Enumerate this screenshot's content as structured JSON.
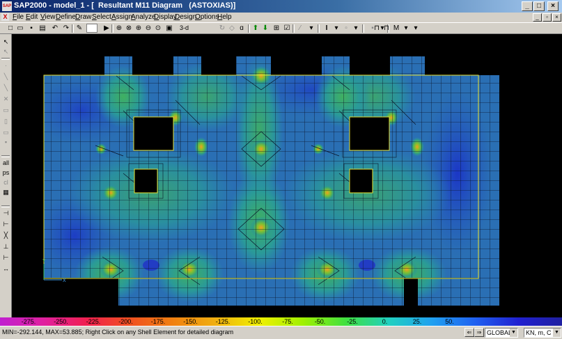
{
  "window": {
    "title": "SAP2000 - model_1 - [  Resultant M11 Diagram   (ASTOXIAS)]",
    "app_icon": "SAP"
  },
  "menu": [
    "File",
    "Edit",
    "View",
    "Define",
    "Draw",
    "Select",
    "Assign",
    "Analyze",
    "Display",
    "Design",
    "Options",
    "Help"
  ],
  "toolbar": {
    "view_3d_label": "3-d",
    "icons": [
      "new-file-icon",
      "open-folder-icon",
      "save-icon",
      "print-icon",
      "undo-icon",
      "redo-icon",
      "pencil-icon",
      "lock-icon",
      "run-icon",
      "zoom-rubber-band-icon",
      "zoom-restore-icon",
      "zoom-in-icon",
      "zoom-out-icon",
      "pan-icon",
      "view-3d-icon",
      "rotate-icon",
      "perspective-icon",
      "up-icon",
      "down-icon",
      "object-shrink-icon",
      "display-options-icon",
      "set-elements-icon",
      "frame-section-icon",
      "joint-icon",
      "shell-icon",
      "deformed-icon",
      "moment-icon"
    ]
  },
  "colors": {
    "diagram_low": "#1f3fd0",
    "diagram_mid": "#2a8fa8",
    "diagram_peak": "#f0a020",
    "mesh_line": "#0a1428",
    "slab_outline": "#e8e030"
  },
  "legend": {
    "ticks": [
      "-275.",
      "-250.",
      "-225.",
      "-200.",
      "-175.",
      "-150.",
      "-125.",
      "-100.",
      "-75.",
      "-50.",
      "-25.",
      "0.",
      "25.",
      "50."
    ],
    "color_stops": [
      "#c020d0",
      "#e020a0",
      "#f02050",
      "#f05020",
      "#f08010",
      "#f0b010",
      "#f0f000",
      "#a0f000",
      "#40e040",
      "#20d0c0",
      "#20a0f0",
      "#2060f0",
      "#2020d0",
      "#2020a0"
    ]
  },
  "status": {
    "text": "MIN=-292.144, MAX=53.885; Right Click on any Shell Element for detailed diagram",
    "coord_system": "GLOBAL",
    "units": "KN, m, C"
  }
}
